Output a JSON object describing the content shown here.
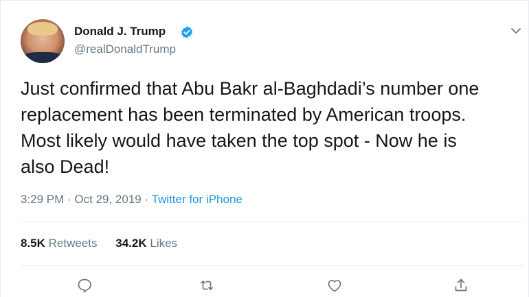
{
  "tweet": {
    "display_name": "Donald J. Trump",
    "handle": "@realDonaldTrump",
    "text": "Just confirmed that Abu Bakr al-Baghdadi’s number one\nreplacement has been terminated by American troops.\nMost likely would have taken the top spot - Now he is\nalso Dead!",
    "time": "3:29 PM",
    "separator": " · ",
    "date": "Oct 29, 2019",
    "source": "Twitter for iPhone",
    "retweets_count": "8.5K",
    "retweets_label": "Retweets",
    "likes_count": "34.2K",
    "likes_label": "Likes"
  },
  "icons": {
    "verified": "verified-badge-icon",
    "menu": "chevron-down-icon",
    "reply": "reply-icon",
    "retweet": "retweet-icon",
    "like": "heart-icon",
    "share": "share-icon"
  },
  "colors": {
    "accent": "#1da1f2",
    "link": "#1b95e0",
    "muted": "#657786",
    "text": "#14171a"
  }
}
